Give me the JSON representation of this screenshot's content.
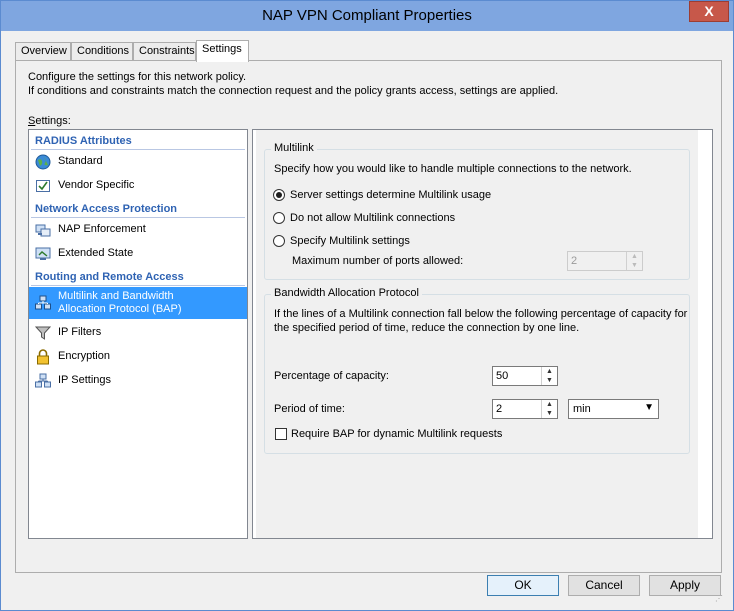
{
  "window": {
    "title": "NAP VPN Compliant Properties",
    "close_glyph": "X"
  },
  "tabs": [
    {
      "label": "Overview"
    },
    {
      "label": "Conditions"
    },
    {
      "label": "Constraints"
    },
    {
      "label": "Settings",
      "active": true
    }
  ],
  "page": {
    "desc_line1": "Configure the settings for this network policy.",
    "desc_line2": "If conditions and constraints match the connection request and the policy grants access, settings are applied.",
    "settings_label": "Settings:"
  },
  "sidebar": {
    "categories": [
      {
        "label": "RADIUS Attributes"
      },
      {
        "label": "Network Access Protection"
      },
      {
        "label": "Routing and Remote Access"
      }
    ],
    "items": [
      {
        "label": "Standard",
        "icon": "globe-icon"
      },
      {
        "label": "Vendor Specific",
        "icon": "vendor-check-icon"
      },
      {
        "label": "NAP Enforcement",
        "icon": "nap-enforcement-icon"
      },
      {
        "label": "Extended State",
        "icon": "extended-state-icon"
      },
      {
        "label": "Multilink and Bandwidth",
        "label2": "Allocation Protocol (BAP)",
        "icon": "multilink-icon",
        "selected": true
      },
      {
        "label": "IP Filters",
        "icon": "filter-icon"
      },
      {
        "label": "Encryption",
        "icon": "lock-icon"
      },
      {
        "label": "IP Settings",
        "icon": "network-icon"
      }
    ]
  },
  "multilink": {
    "group_title": "Multilink",
    "description": "Specify how you would like to handle multiple connections to the network.",
    "options": [
      {
        "label": "Server settings determine Multilink usage",
        "checked": true
      },
      {
        "label": "Do not allow Multilink connections",
        "checked": false
      },
      {
        "label": "Specify Multilink settings",
        "checked": false
      }
    ],
    "max_ports_label": "Maximum number of ports allowed:",
    "max_ports_value": "2"
  },
  "bap": {
    "group_title": "Bandwidth Allocation Protocol",
    "description_line1": "If the lines of a Multilink connection fall below the following percentage of capacity for",
    "description_line2": "the specified period of time, reduce the connection by one line.",
    "capacity_label": "Percentage of capacity:",
    "capacity_value": "50",
    "period_label": "Period of time:",
    "period_value": "2",
    "period_unit": "min",
    "require_bap_label": "Require BAP for dynamic Multilink requests",
    "require_bap_checked": false
  },
  "footer": {
    "ok": "OK",
    "cancel": "Cancel",
    "apply": "Apply"
  },
  "colors": {
    "titlebar": "#7fa6e0",
    "close_button": "#c7584a",
    "category_text": "#2f63b3",
    "selection": "#3399ff"
  }
}
